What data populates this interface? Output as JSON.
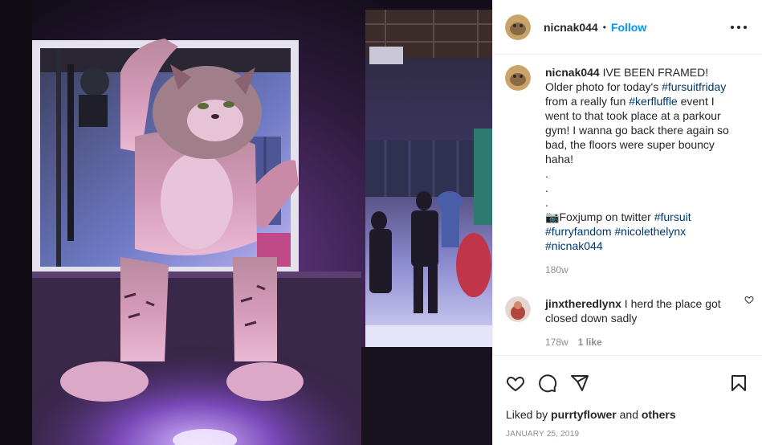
{
  "post": {
    "author": "nicnak044",
    "follow_label": "Follow",
    "separator": "•",
    "caption_lines": [
      "IVE BEEN FRAMED!",
      "Older photo for today's ",
      "from a really fun ",
      "went to that took place at a parkour",
      "gym! I wanna go back there again so",
      "bad, the floors were super bouncy",
      "haha!"
    ],
    "hashtags": {
      "fursuitfriday": "#fursuitfriday",
      "kerfluffle": "#kerfluffle",
      "fursuit": "#fursuit",
      "furryfandom": "#furryfandom",
      "nicolethelynx": "#nicolethelynx",
      "nicnak044": "#nicnak044"
    },
    "caption_after_kerfluffle": " event I",
    "dots": [
      ".",
      ".",
      "."
    ],
    "camera_emoji": "📷",
    "credit_text": "Foxjump on twitter ",
    "caption_time": "180w"
  },
  "comments": [
    {
      "username": "jinxtheredlynx",
      "text": " I herd the place got",
      "text2": "closed down sadly",
      "time": "178w",
      "likes": "1 like"
    }
  ],
  "footer": {
    "liked_by_prefix": "Liked by ",
    "liked_by_user": "purrtyflower",
    "liked_by_mid": " and ",
    "liked_by_others": "others",
    "date": "JANUARY 25, 2019"
  },
  "colors": {
    "link_blue": "#0095f6",
    "hashtag": "#00376b",
    "muted": "#8e8e8e"
  },
  "icons": {
    "more": "more-options-icon",
    "like": "heart-icon",
    "comment": "comment-icon",
    "share": "share-icon",
    "save": "bookmark-icon"
  }
}
